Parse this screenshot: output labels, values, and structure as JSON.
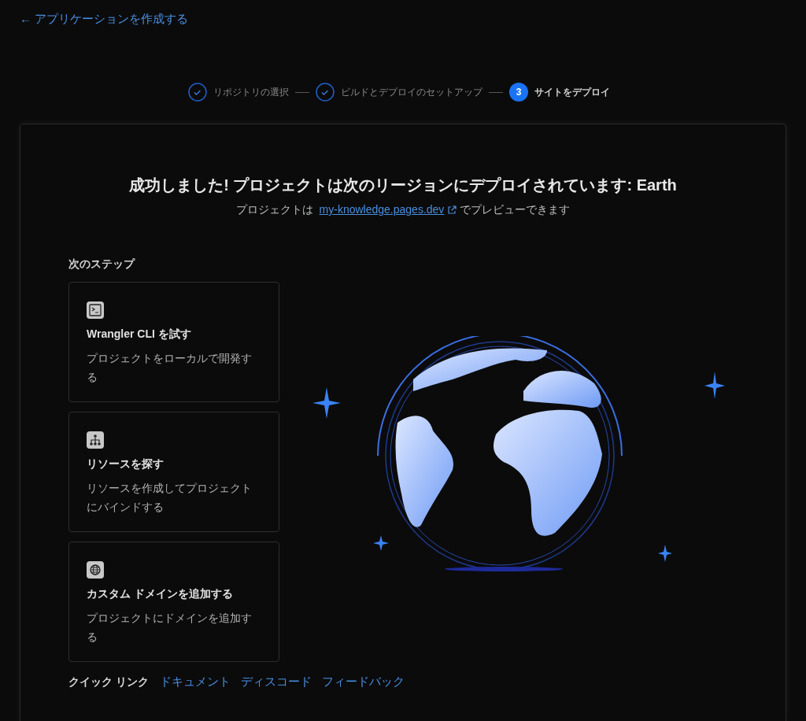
{
  "back_link": {
    "arrow": "←",
    "label": "アプリケーションを作成する"
  },
  "steps": [
    {
      "label": "リポジトリの選択",
      "completed": true
    },
    {
      "label": "ビルドとデプロイのセットアップ",
      "completed": true
    },
    {
      "label": "サイトをデプロイ",
      "number": "3",
      "completed": false
    }
  ],
  "result": {
    "title": "成功しました! プロジェクトは次のリージョンにデプロイされています: Earth",
    "preview_prefix": "プロジェクトは",
    "preview_link": "my-knowledge.pages.dev",
    "preview_suffix": "でプレビューできます"
  },
  "next_steps": {
    "heading": "次のステップ",
    "cards": [
      {
        "kind": "terminal",
        "title": "Wrangler CLI を試す",
        "description": "プロジェクトをローカルで開発する"
      },
      {
        "kind": "resources",
        "title": "リソースを探す",
        "description": "リソースを作成してプロジェクトにバインドする"
      },
      {
        "kind": "globe",
        "title": "カスタム ドメインを追加する",
        "description": "プロジェクトにドメインを追加する"
      }
    ]
  },
  "quick_links": {
    "label": "クイック リンク",
    "links": [
      "ドキュメント",
      "ディスコード",
      "フィードバック"
    ]
  }
}
